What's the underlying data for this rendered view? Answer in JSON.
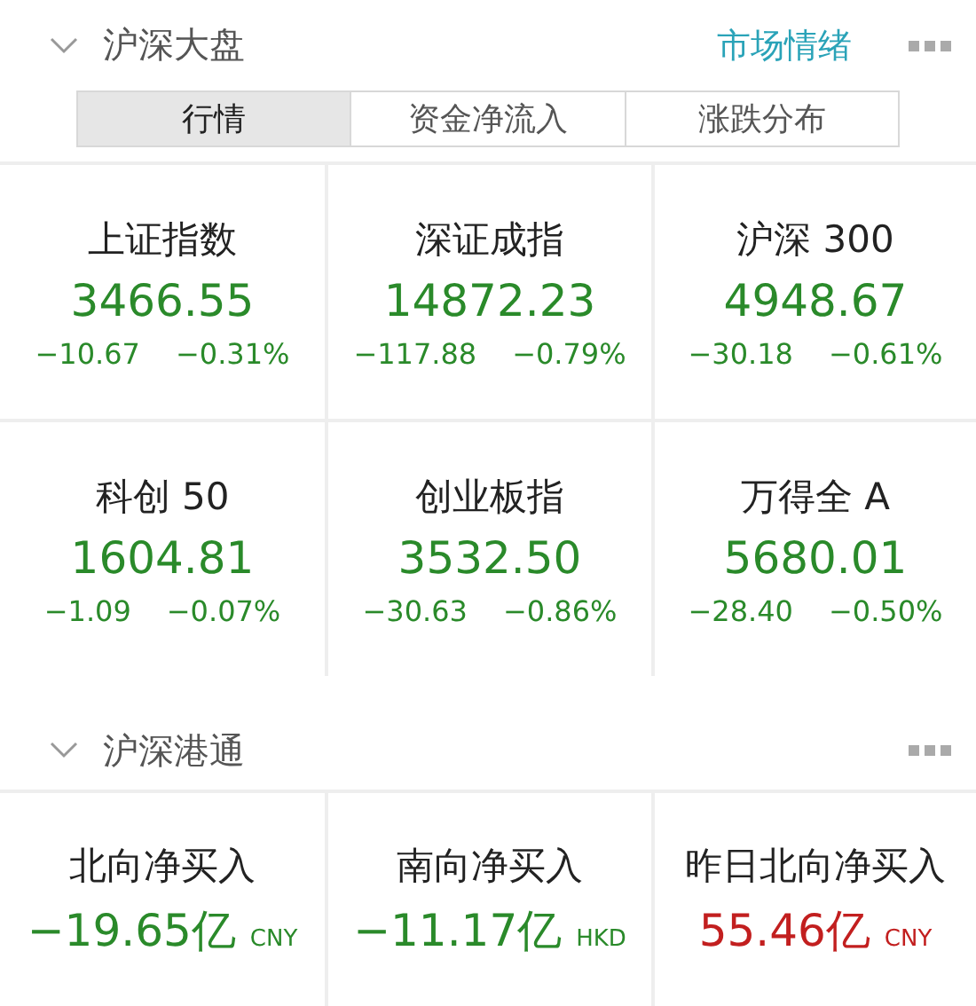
{
  "market": {
    "title": "沪深大盘",
    "link": "市场情绪",
    "expanded": true,
    "tabs": [
      {
        "label": "行情",
        "selected": true
      },
      {
        "label": "资金净流入",
        "selected": false
      },
      {
        "label": "涨跌分布",
        "selected": false
      }
    ],
    "indices": [
      {
        "name": "上证指数",
        "value": "3466.55",
        "change": "−10.67",
        "percent": "−0.31%",
        "color": "#2a8a2a"
      },
      {
        "name": "深证成指",
        "value": "14872.23",
        "change": "−117.88",
        "percent": "−0.79%",
        "color": "#2a8a2a"
      },
      {
        "name": "沪深 300",
        "value": "4948.67",
        "change": "−30.18",
        "percent": "−0.61%",
        "color": "#2a8a2a"
      },
      {
        "name": "科创 50",
        "value": "1604.81",
        "change": "−1.09",
        "percent": "−0.07%",
        "color": "#2a8a2a"
      },
      {
        "name": "创业板指",
        "value": "3532.50",
        "change": "−30.63",
        "percent": "−0.86%",
        "color": "#2a8a2a"
      },
      {
        "name": "万得全 A",
        "value": "5680.01",
        "change": "−28.40",
        "percent": "−0.50%",
        "color": "#2a8a2a"
      }
    ]
  },
  "connect": {
    "title": "沪深港通",
    "expanded": true,
    "flows": [
      {
        "name": "北向净买入",
        "value": "−19.65亿",
        "currency": "CNY",
        "color": "#2a8a2a"
      },
      {
        "name": "南向净买入",
        "value": "−11.17亿",
        "currency": "HKD",
        "color": "#2a8a2a"
      },
      {
        "name": "昨日北向净买入",
        "value": "55.46亿",
        "currency": "CNY",
        "color": "#c21f1f"
      }
    ]
  }
}
